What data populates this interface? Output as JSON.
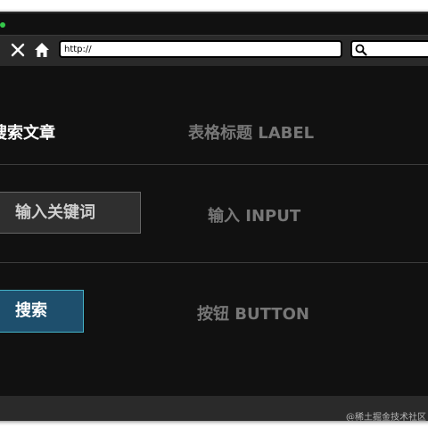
{
  "toolbar": {
    "icons": [
      "close-icon",
      "home-icon",
      "search-icon"
    ],
    "url_value": "http://",
    "search_value": ""
  },
  "rows": [
    {
      "left_text": "搜索文章",
      "right_text": "表格标题 LABEL"
    },
    {
      "left_text": "输入关键词",
      "right_text": "输入 INPUT"
    },
    {
      "left_text": "搜索",
      "right_text": "按钮 BUTTON"
    }
  ],
  "watermark": "@稀土掘金技术社区",
  "colors": {
    "window_bg": "#111111",
    "toolbar_bg": "#2a2a2a",
    "label_dim": "#777777",
    "button_bg": "#1e4f6d",
    "button_border": "#45b3c8",
    "input_bg": "#2f2f2f",
    "traffic_light": "#35c84a"
  }
}
